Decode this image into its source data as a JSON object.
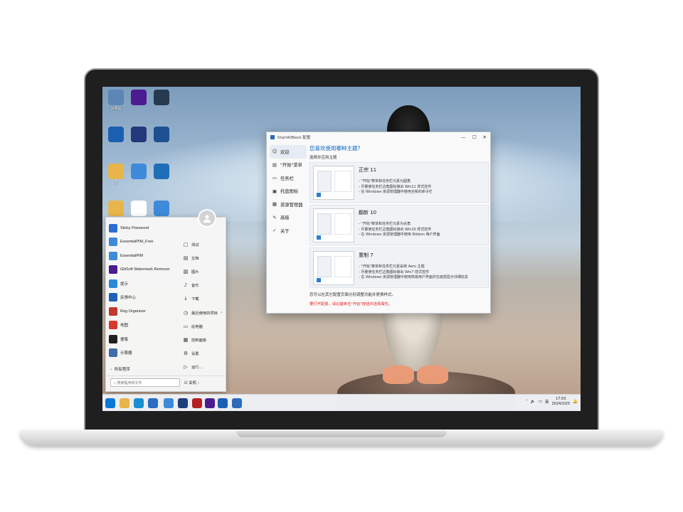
{
  "desktop": {
    "icons": [
      {
        "label": "回收站",
        "icon": "recycle-bin-icon",
        "color": "#5d86b6"
      },
      {
        "label": "",
        "icon": "gilisoft-icon",
        "color": "#4b1b8f"
      },
      {
        "label": "",
        "icon": "app-icon",
        "color": "#263a4f"
      },
      {
        "label": "",
        "icon": "advanced-systemcare-icon",
        "color": "#1b5fb0"
      },
      {
        "label": "",
        "icon": "disk-icon",
        "color": "#22387a"
      },
      {
        "label": "",
        "icon": "print-conductor-icon",
        "color": "#1d4f91"
      },
      {
        "label": "Z",
        "icon": "folder-icon",
        "color": "#e8b54a"
      },
      {
        "label": "",
        "icon": "essentialpim-icon",
        "color": "#3d8ad8"
      },
      {
        "label": "",
        "icon": "app-icon",
        "color": "#1e6fb8"
      },
      {
        "label": "",
        "icon": "folder-icon",
        "color": "#e8b54a"
      },
      {
        "label": "",
        "icon": "puzzle-icon",
        "color": "#ffffff"
      },
      {
        "label": "",
        "icon": "essentialpim-icon",
        "color": "#3d8ad8"
      }
    ]
  },
  "start_menu": {
    "apps": [
      {
        "label": "Sticky Password",
        "icon": "sticky-password-icon",
        "color": "#2a6fcf"
      },
      {
        "label": "EssentialPIM_Free",
        "icon": "essentialpim-icon",
        "color": "#3d8ad8"
      },
      {
        "label": "EssentialPIM",
        "icon": "essentialpim-icon",
        "color": "#3d8ad8"
      },
      {
        "label": "GiliSoft Watermark Remover",
        "icon": "gilisoft-icon",
        "color": "#4b1b8f"
      },
      {
        "label": "提示",
        "icon": "tips-icon",
        "color": "#2a8ad8"
      },
      {
        "label": "反馈中心",
        "icon": "feedback-hub-icon",
        "color": "#2060b8"
      },
      {
        "label": "Reg Organizer",
        "icon": "reg-organizer-icon",
        "color": "#c0392b"
      },
      {
        "label": "地图",
        "icon": "maps-icon",
        "color": "#d9382c"
      },
      {
        "label": "便笺",
        "icon": "sticky-notes-icon",
        "color": "#202020"
      },
      {
        "label": "计算器",
        "icon": "calculator-icon",
        "color": "#3f6ea8"
      }
    ],
    "places": [
      {
        "label": "测试",
        "icon": "document-icon"
      },
      {
        "label": "文档",
        "icon": "documents-icon"
      },
      {
        "label": "图片",
        "icon": "pictures-icon"
      },
      {
        "label": "音乐",
        "icon": "music-icon"
      },
      {
        "label": "下载",
        "icon": "download-icon"
      },
      {
        "label": "最近使用的项目",
        "icon": "recent-icon"
      },
      {
        "label": "此电脑",
        "icon": "computer-icon"
      },
      {
        "label": "控制面板",
        "icon": "control-panel-icon"
      },
      {
        "label": "设置",
        "icon": "settings-icon"
      },
      {
        "label": "运行...",
        "icon": "run-icon"
      }
    ],
    "all_programs": "所有程序",
    "search_placeholder": "搜索程序和文件",
    "power_label": "关机"
  },
  "window": {
    "title": "StartAllBack 配置",
    "nav": [
      {
        "label": "欢迎",
        "icon": "welcome-icon"
      },
      {
        "label": "\"开始\"菜单",
        "icon": "start-menu-icon"
      },
      {
        "label": "任务栏",
        "icon": "taskbar-icon"
      },
      {
        "label": "托盘图标",
        "icon": "tray-icon"
      },
      {
        "label": "资源管理器",
        "icon": "explorer-icon"
      },
      {
        "label": "高级",
        "icon": "wrench-icon"
      },
      {
        "label": "关于",
        "icon": "about-icon"
      }
    ],
    "heading": "您喜欢使用哪种主题?",
    "subheading": "选择并应用主题",
    "themes": [
      {
        "name": "正宗 11",
        "features": [
          "- \"开始\"菜单和任务栏元素为圆角",
          "- 尽量使任务栏边角图标弹出 Win11 样式控件",
          "- 在 Windows 资源管理器中使用全新的命令栏"
        ]
      },
      {
        "name": "翻新 10",
        "features": [
          "- \"开始\"菜单和任务栏元素为尖角",
          "- 尽量使任务栏边角图标弹出 Win10 样式控件",
          "- 在 Windows 资源管理器中使用 Ribbon 用户界面"
        ]
      },
      {
        "name": "重制 7",
        "features": [
          "- \"开始\"菜单和任务栏元素采用 Aero 主题",
          "- 尽量使任务栏边角图标弹出 Win7 样式控件",
          "- 在 Windows 资源管理器中使用简易用户界面并在底部显示详细信息"
        ]
      }
    ],
    "note": "您可以在其它配置页面分别调整功能并更换样式。",
    "warning": "要打开配置，请右键单击\"开始\"按钮并选择属性。"
  },
  "taskbar": {
    "buttons": [
      {
        "icon": "windows-start-icon",
        "color": "#0a78d7"
      },
      {
        "icon": "file-explorer-icon",
        "color": "#e8b54a"
      },
      {
        "icon": "edge-icon",
        "color": "#1b8fd0"
      },
      {
        "icon": "store-icon",
        "color": "#2a6cc0"
      },
      {
        "icon": "essentialpim-icon",
        "color": "#3d8ad8"
      },
      {
        "icon": "app-icon",
        "color": "#1d3f7a"
      },
      {
        "icon": "record-icon",
        "color": "#b52020"
      },
      {
        "icon": "gilisoft-icon",
        "color": "#4b1b8f"
      },
      {
        "icon": "advanced-systemcare-icon",
        "color": "#1b5fb0"
      },
      {
        "icon": "phone-icon",
        "color": "#2c6bb8"
      }
    ],
    "tray": {
      "input_method": "英",
      "time": "17:03",
      "date": "2024/10/5"
    }
  }
}
